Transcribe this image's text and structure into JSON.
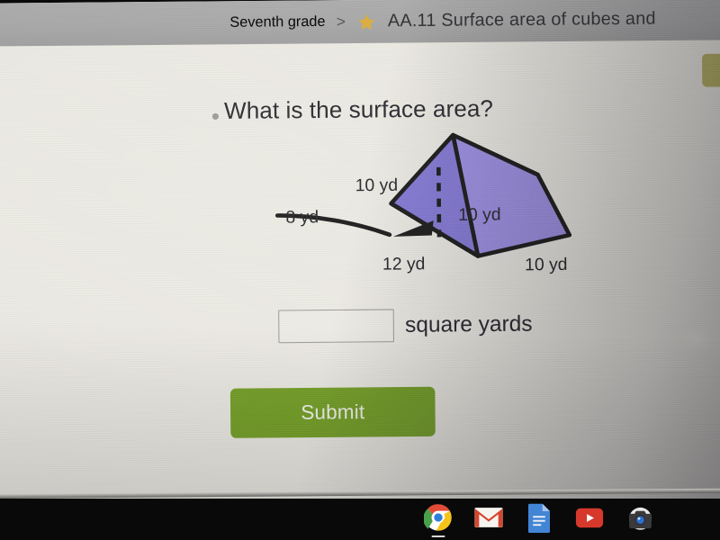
{
  "header": {
    "grade": "Seventh grade",
    "separator": ">",
    "star_icon": "star-icon",
    "skill": "AA.11 Surface area of cubes and"
  },
  "badge": {
    "color": "#b4ae5c"
  },
  "question": {
    "bullet": "",
    "text": "What is the surface area?"
  },
  "figure": {
    "shape": "triangular prism",
    "fill_color": "#8d7edd",
    "fill_color_side": "#9a8ce4",
    "stroke_color": "#121212",
    "labels": {
      "slant": "10 yd",
      "height": "8 yd",
      "base": "12 yd",
      "depth": "10 yd",
      "side": "10 yd"
    }
  },
  "answer": {
    "value": "",
    "placeholder": "",
    "unit": "square yards"
  },
  "submit": {
    "label": "Submit",
    "color": "#74a026"
  },
  "shelf": {
    "items": [
      {
        "name": "chrome-icon",
        "label": "Chrome"
      },
      {
        "name": "gmail-icon",
        "label": "Gmail"
      },
      {
        "name": "docs-icon",
        "label": "Docs"
      },
      {
        "name": "youtube-icon",
        "label": "YouTube"
      },
      {
        "name": "camera-icon",
        "label": "Camera"
      }
    ]
  }
}
